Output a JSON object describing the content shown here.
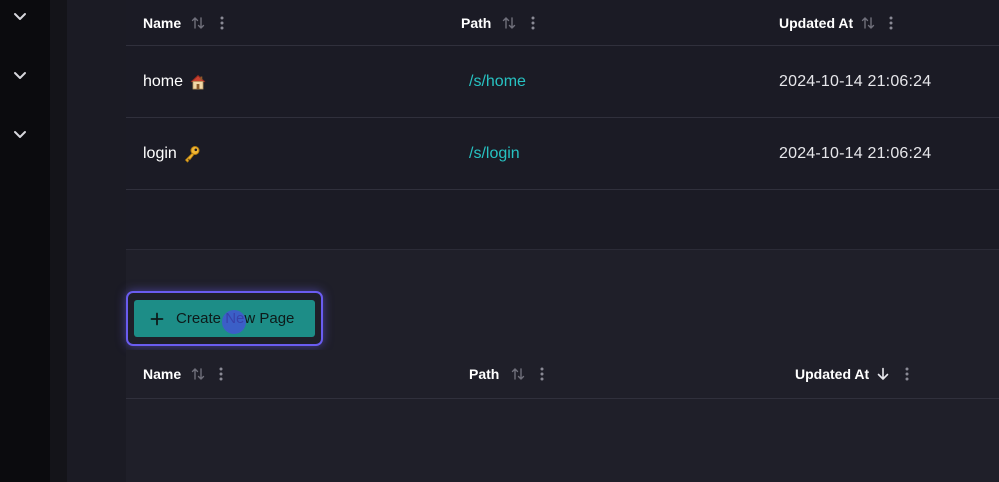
{
  "sidebar": {
    "chevrons": [
      "chevron-down-icon",
      "chevron-down-icon",
      "chevron-down-icon"
    ]
  },
  "table1": {
    "columns": [
      {
        "label": "Name",
        "sort_icon": "sort-icon"
      },
      {
        "label": "Path",
        "sort_icon": "sort-icon"
      },
      {
        "label": "Updated At",
        "sort_icon": "sort-icon"
      }
    ],
    "rows": [
      {
        "name": "home",
        "emoji": "house-emoji-icon",
        "path": "/s/home",
        "updated_at": "2024-10-14 21:06:24"
      },
      {
        "name": "login",
        "emoji": "key-emoji-icon",
        "path": "/s/login",
        "updated_at": "2024-10-14 21:06:24"
      }
    ]
  },
  "create_button": {
    "label": "Create New Page",
    "icon": "plus-icon"
  },
  "table2": {
    "columns": [
      {
        "label": "Name",
        "sort_icon": "sort-icon"
      },
      {
        "label": "Path",
        "sort_icon": "sort-icon"
      },
      {
        "label": "Updated At",
        "sort_icon": "arrow-down-icon"
      }
    ]
  },
  "colors": {
    "accent_teal": "#27c2c2",
    "button_bg": "#1d8d87",
    "focus_ring": "#6a5cf0",
    "background": "#1f1f29"
  }
}
